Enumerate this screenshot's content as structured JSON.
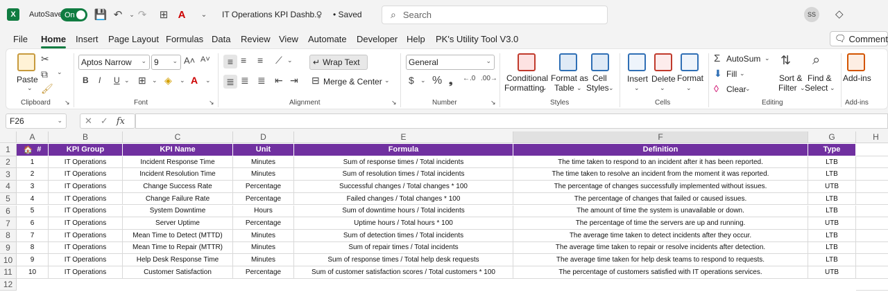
{
  "titlebar": {
    "app_logo": "X",
    "autosave_label": "AutoSave",
    "autosave_state": "On",
    "doc_title": "IT Operations KPI Dashb...",
    "save_status": "• Saved",
    "search_placeholder": "Search",
    "avatar_initials": "SS"
  },
  "menu": {
    "tabs": [
      "File",
      "Home",
      "Insert",
      "Page Layout",
      "Formulas",
      "Data",
      "Review",
      "View",
      "Automate",
      "Developer",
      "Help",
      "PK's Utility Tool V3.0"
    ],
    "active": "Home",
    "comments_label": "Comments"
  },
  "ribbon": {
    "clipboard": {
      "paste": "Paste",
      "label": "Clipboard"
    },
    "font": {
      "name": "Aptos Narrow",
      "size": "9",
      "label": "Font"
    },
    "alignment": {
      "wrap_text": "Wrap Text",
      "merge_center": "Merge & Center",
      "label": "Alignment"
    },
    "number": {
      "format": "General",
      "label": "Number"
    },
    "styles": {
      "conditional": "Conditional",
      "formatting": "Formatting",
      "format_as": "Format as",
      "table": "Table",
      "cell": "Cell",
      "styles": "Styles",
      "label": "Styles"
    },
    "cells": {
      "insert": "Insert",
      "delete": "Delete",
      "format": "Format",
      "label": "Cells"
    },
    "editing": {
      "autosum": "AutoSum",
      "fill": "Fill",
      "clear": "Clear",
      "sort": "Sort &",
      "filter": "Filter",
      "find": "Find &",
      "select": "Select",
      "label": "Editing"
    },
    "addins": {
      "addins": "Add-ins",
      "label": "Add-ins"
    }
  },
  "formula_bar": {
    "name_box": "F26",
    "formula": ""
  },
  "sheet": {
    "columns": [
      "A",
      "B",
      "C",
      "D",
      "E",
      "F",
      "G",
      "H"
    ],
    "selected_column": "F",
    "row_numbers": [
      "1",
      "2",
      "3",
      "4",
      "5",
      "6",
      "7",
      "8",
      "9",
      "10",
      "11",
      "12"
    ],
    "headers": [
      "#",
      "KPI Group",
      "KPI Name",
      "Unit",
      "Formula",
      "Definition",
      "Type"
    ],
    "rows": [
      [
        "1",
        "IT Operations",
        "Incident Response Time",
        "Minutes",
        "Sum of response times / Total incidents",
        "The time taken to respond to an incident after it has been reported.",
        "LTB"
      ],
      [
        "2",
        "IT Operations",
        "Incident Resolution Time",
        "Minutes",
        "Sum of resolution times / Total incidents",
        "The time taken to resolve an incident from the moment it was reported.",
        "LTB"
      ],
      [
        "3",
        "IT Operations",
        "Change Success Rate",
        "Percentage",
        "Successful changes / Total changes * 100",
        "The percentage of changes successfully implemented without issues.",
        "UTB"
      ],
      [
        "4",
        "IT Operations",
        "Change Failure Rate",
        "Percentage",
        "Failed changes / Total changes * 100",
        "The percentage of changes that failed or caused issues.",
        "LTB"
      ],
      [
        "5",
        "IT Operations",
        "System Downtime",
        "Hours",
        "Sum of downtime hours / Total incidents",
        "The amount of time the system is unavailable or down.",
        "LTB"
      ],
      [
        "6",
        "IT Operations",
        "Server Uptime",
        "Percentage",
        "Uptime hours / Total hours * 100",
        "The percentage of time the servers are up and running.",
        "UTB"
      ],
      [
        "7",
        "IT Operations",
        "Mean Time to Detect (MTTD)",
        "Minutes",
        "Sum of detection times / Total incidents",
        "The average time taken to detect incidents after they occur.",
        "LTB"
      ],
      [
        "8",
        "IT Operations",
        "Mean Time to Repair (MTTR)",
        "Minutes",
        "Sum of repair times / Total incidents",
        "The average time taken to repair or resolve incidents after detection.",
        "LTB"
      ],
      [
        "9",
        "IT Operations",
        "Help Desk Response Time",
        "Minutes",
        "Sum of response times / Total help desk requests",
        "The average time taken for help desk teams to respond to requests.",
        "LTB"
      ],
      [
        "10",
        "IT Operations",
        "Customer Satisfaction",
        "Percentage",
        "Sum of customer satisfaction scores / Total customers * 100",
        "The percentage of customers satisfied with IT operations services.",
        "UTB"
      ]
    ]
  },
  "colors": {
    "header_bg": "#7030a0",
    "excel_green": "#107c41"
  }
}
